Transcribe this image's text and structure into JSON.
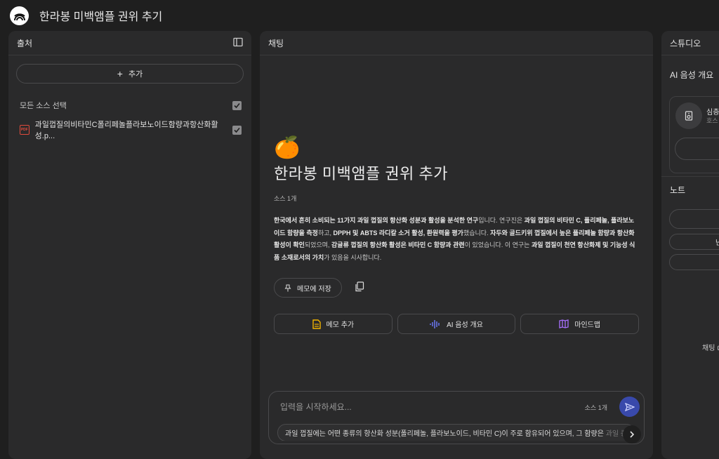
{
  "app": {
    "title": "한라봉 미백앰플 권위 추기"
  },
  "sources": {
    "header": "출처",
    "add_label": "추가",
    "select_all_label": "모든 소스 선택",
    "items": [
      {
        "name": "과일껍질의비타민C폴리페놀플라보노이드함량과항산화활성.p..."
      }
    ]
  },
  "chat": {
    "header": "채팅",
    "emoji": "🍊",
    "title": "한라봉 미백앰플 권위 추가",
    "source_count": "소스 1개",
    "summary": [
      {
        "t": "한국에서 흔히 소비되는 11가지 과일 껍질의 항산화 성분과 활성을 분석한 연구",
        "b": true
      },
      {
        "t": "입니다. 연구진은 ",
        "b": false
      },
      {
        "t": "과일 껍질의 비타민 C, 폴리페놀, 플라보노이드 함량을 측정",
        "b": true
      },
      {
        "t": "하고, ",
        "b": false
      },
      {
        "t": "DPPH 및 ABTS 라디칼 소거 활성, 환원력을 평가",
        "b": true
      },
      {
        "t": "했습니다. ",
        "b": false
      },
      {
        "t": "자두와 골드키위 껍질에서 높은 폴리페놀 함량과 항산화 활성이 확인",
        "b": true
      },
      {
        "t": "되었으며, ",
        "b": false
      },
      {
        "t": "감귤류 껍질의 항산화 활성은 비타민 C 함량과 관련",
        "b": true
      },
      {
        "t": "이 있었습니다. 이 연구는 ",
        "b": false
      },
      {
        "t": "과일 껍질이 천연 항산화제 및 기능성 식품 소재로서의 가치",
        "b": true
      },
      {
        "t": "가 있음을 시사합니다.",
        "b": false
      }
    ],
    "save_memo_label": "메모에 저장",
    "actions": {
      "add_memo": "메모 추가",
      "audio_overview": "AI 음성 개요",
      "mindmap": "마인드맵"
    },
    "input": {
      "placeholder": "입력을 시작하세요...",
      "source_count": "소스 1개"
    },
    "suggestion": {
      "text": "과일 껍질에는 어떤 종류의 항산화 성분(폴리페놀, 플라보노이드, 비타민 C)이 주로 함유되어 있으며, 그 함량은",
      "fade": " 과일 종"
    }
  },
  "studio": {
    "header": "스튜디오",
    "audio_title": "AI 음성 개요",
    "audio_card_t1": "심층",
    "audio_card_t2": "호스",
    "notes_title": "노트",
    "note_button_partial": "난",
    "chat_hint": "채팅 ៣"
  },
  "colors": {
    "background": "#1f1f1f",
    "panel": "#2a2a2b",
    "send_button": "#3949ab",
    "pdf_icon": "#e04b3c",
    "memo_icon": "#f2b400",
    "audio_icon": "#6f7cff",
    "mindmap_icon": "#a970ff"
  }
}
